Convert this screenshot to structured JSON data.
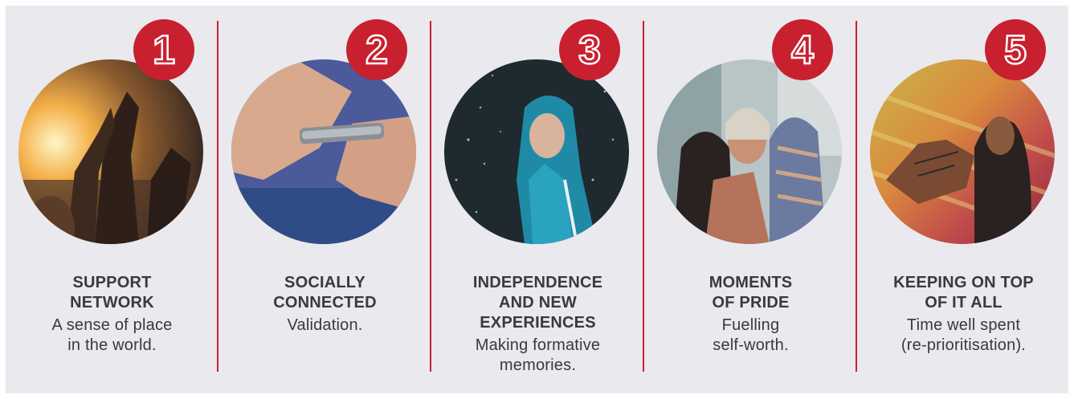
{
  "colors": {
    "accent": "#c8202f",
    "panel": "#e9e9ee",
    "text": "#3a3a3a"
  },
  "items": [
    {
      "number": "1",
      "heading": "SUPPORT\nNETWORK",
      "description": "A sense of place\nin the world.",
      "photo": "friends-high-five-sunset"
    },
    {
      "number": "2",
      "heading": "SOCIALLY\nCONNECTED",
      "description": "Validation.",
      "photo": "hands-holding-smartphone"
    },
    {
      "number": "3",
      "heading": "INDEPENDENCE\nAND NEW\nEXPERIENCES",
      "description": "Making formative\nmemories.",
      "photo": "woman-in-rain-hood"
    },
    {
      "number": "4",
      "heading": "MOMENTS\nOF PRIDE",
      "description": "Fuelling\nself-worth.",
      "photo": "friends-group-hug"
    },
    {
      "number": "5",
      "heading": "KEEPING ON TOP\nOF IT ALL",
      "description": "Time well spent\n(re-prioritisation).",
      "photo": "hand-believe-in-your-dream"
    }
  ]
}
